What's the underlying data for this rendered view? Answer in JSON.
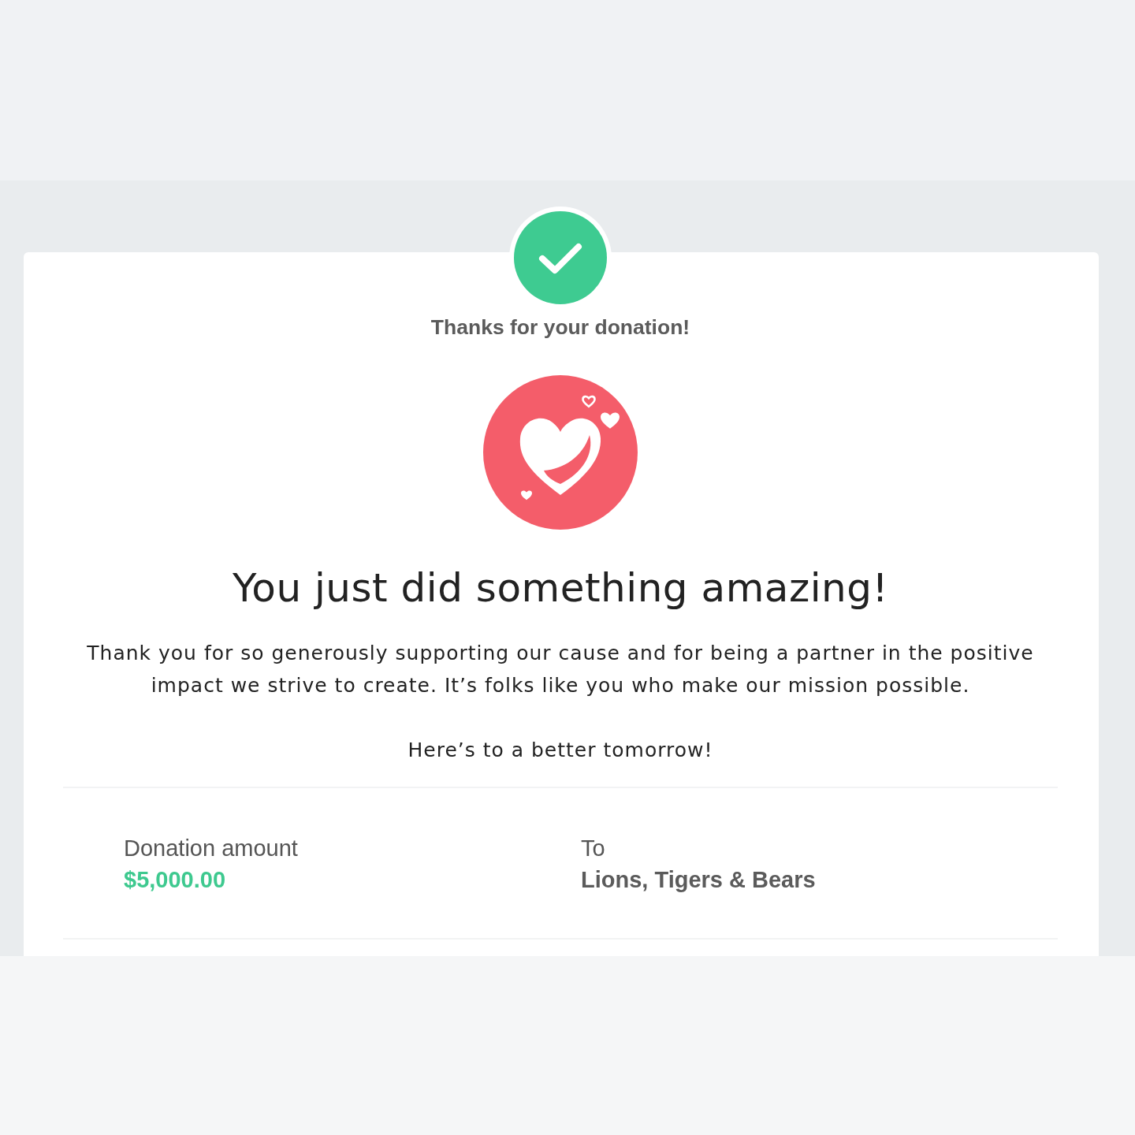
{
  "confirmation": {
    "status": "Thanks for your donation!"
  },
  "headline": "You just did something amazing!",
  "message": "Thank you for so generously supporting our cause and for being a partner in the positive impact we strive to create. It’s folks like you who make our mission possible.",
  "closing": "Here’s to a better tomorrow!",
  "details": [
    {
      "kind": "amount",
      "label": "Donation amount",
      "value": "$5,000.00"
    },
    {
      "kind": "recipient",
      "label": "To",
      "value": "Lions, Tigers & Bears"
    }
  ]
}
